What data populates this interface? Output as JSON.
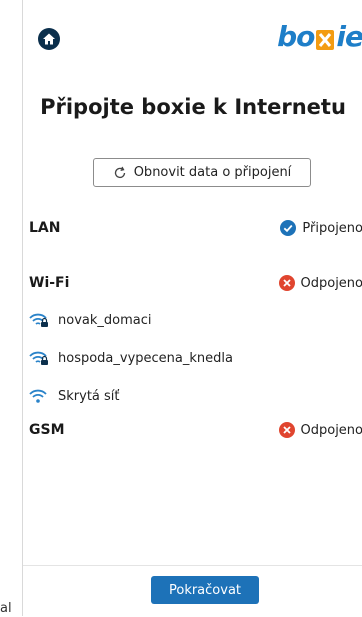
{
  "header": {
    "logo_text_left": "bo",
    "logo_text_right": "ie",
    "brand_color": "#1e7ec8",
    "logo_x_color": "#f39c12"
  },
  "title": "Připojte boxie k Internetu",
  "refresh_button": {
    "label": "Obnovit data o připojení",
    "icon": "refresh-icon"
  },
  "connections": {
    "lan": {
      "label": "LAN",
      "status": "Připojeno",
      "status_icon": "check-circle-icon",
      "status_color": "#1d72b8"
    },
    "wifi": {
      "label": "Wi-Fi",
      "status": "Odpojeno",
      "status_icon": "x-circle-icon",
      "status_color": "#e0452f",
      "networks": [
        {
          "ssid": "novak_domaci",
          "icon": "wifi-lock-icon"
        },
        {
          "ssid": "hospoda_vypecena_knedla",
          "icon": "wifi-lock-icon"
        },
        {
          "ssid": "Skrytá síť",
          "icon": "wifi-icon"
        }
      ]
    },
    "gsm": {
      "label": "GSM",
      "status": "Odpojeno",
      "status_icon": "x-circle-icon",
      "status_color": "#e0452f"
    }
  },
  "footer": {
    "continue_label": "Pokračovat"
  },
  "cutoff_text": "al"
}
